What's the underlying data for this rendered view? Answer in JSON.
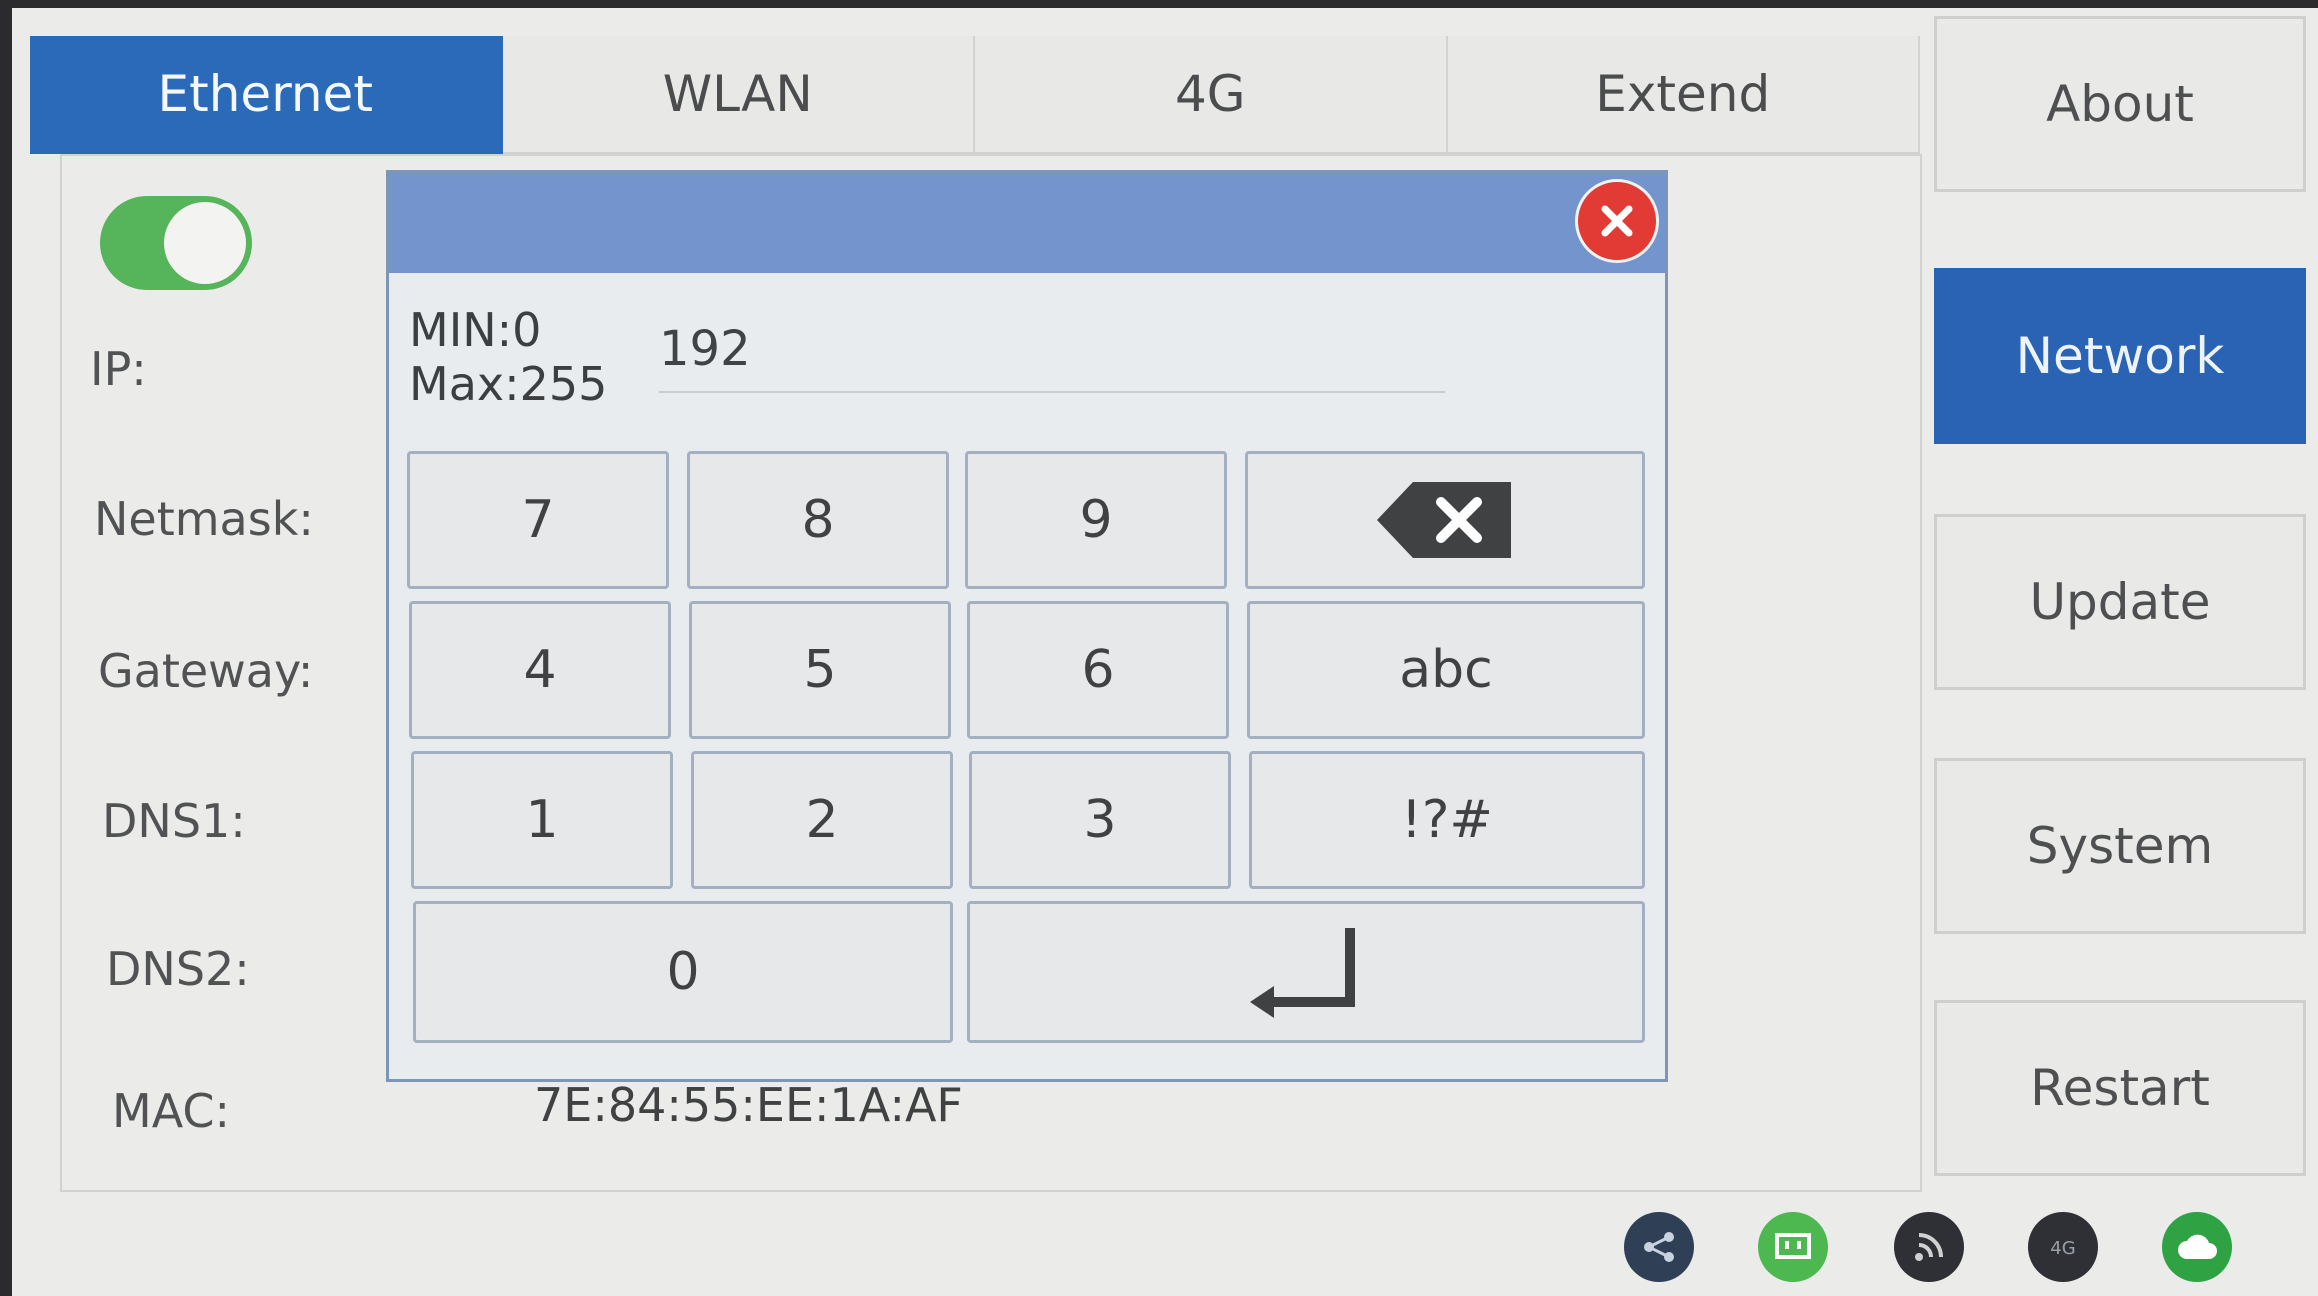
{
  "tabs": [
    {
      "label": "Ethernet",
      "active": true
    },
    {
      "label": "WLAN",
      "active": false
    },
    {
      "label": "4G",
      "active": false
    },
    {
      "label": "Extend",
      "active": false
    }
  ],
  "nav": [
    {
      "label": "About",
      "active": false
    },
    {
      "label": "Network",
      "active": true
    },
    {
      "label": "Update",
      "active": false
    },
    {
      "label": "System",
      "active": false
    },
    {
      "label": "Restart",
      "active": false
    }
  ],
  "ethernet": {
    "enabled": true,
    "fields": {
      "ip_label": "IP:",
      "netmask_label": "Netmask:",
      "gateway_label": "Gateway:",
      "dns1_label": "DNS1:",
      "dns2_label": "DNS2:",
      "mac_label": "MAC:"
    },
    "mac_value": "7E:84:55:EE:1A:AF"
  },
  "keypad": {
    "min_label": "MIN:0",
    "max_label": "Max:255",
    "input_value": "192",
    "keys": {
      "k7": "7",
      "k8": "8",
      "k9": "9",
      "k4": "4",
      "k5": "5",
      "k6": "6",
      "k1": "1",
      "k2": "2",
      "k3": "3",
      "k0": "0",
      "abc": "abc",
      "symbols": "!?#"
    }
  },
  "colors": {
    "accent": "#2a6ab8",
    "dialog_header": "#7394cc",
    "toggle_on": "#56b45a",
    "close": "#e23a35"
  },
  "status_icons": [
    "share-icon",
    "ethernet-icon",
    "wifi-icon",
    "4g-icon",
    "cloud-icon"
  ]
}
